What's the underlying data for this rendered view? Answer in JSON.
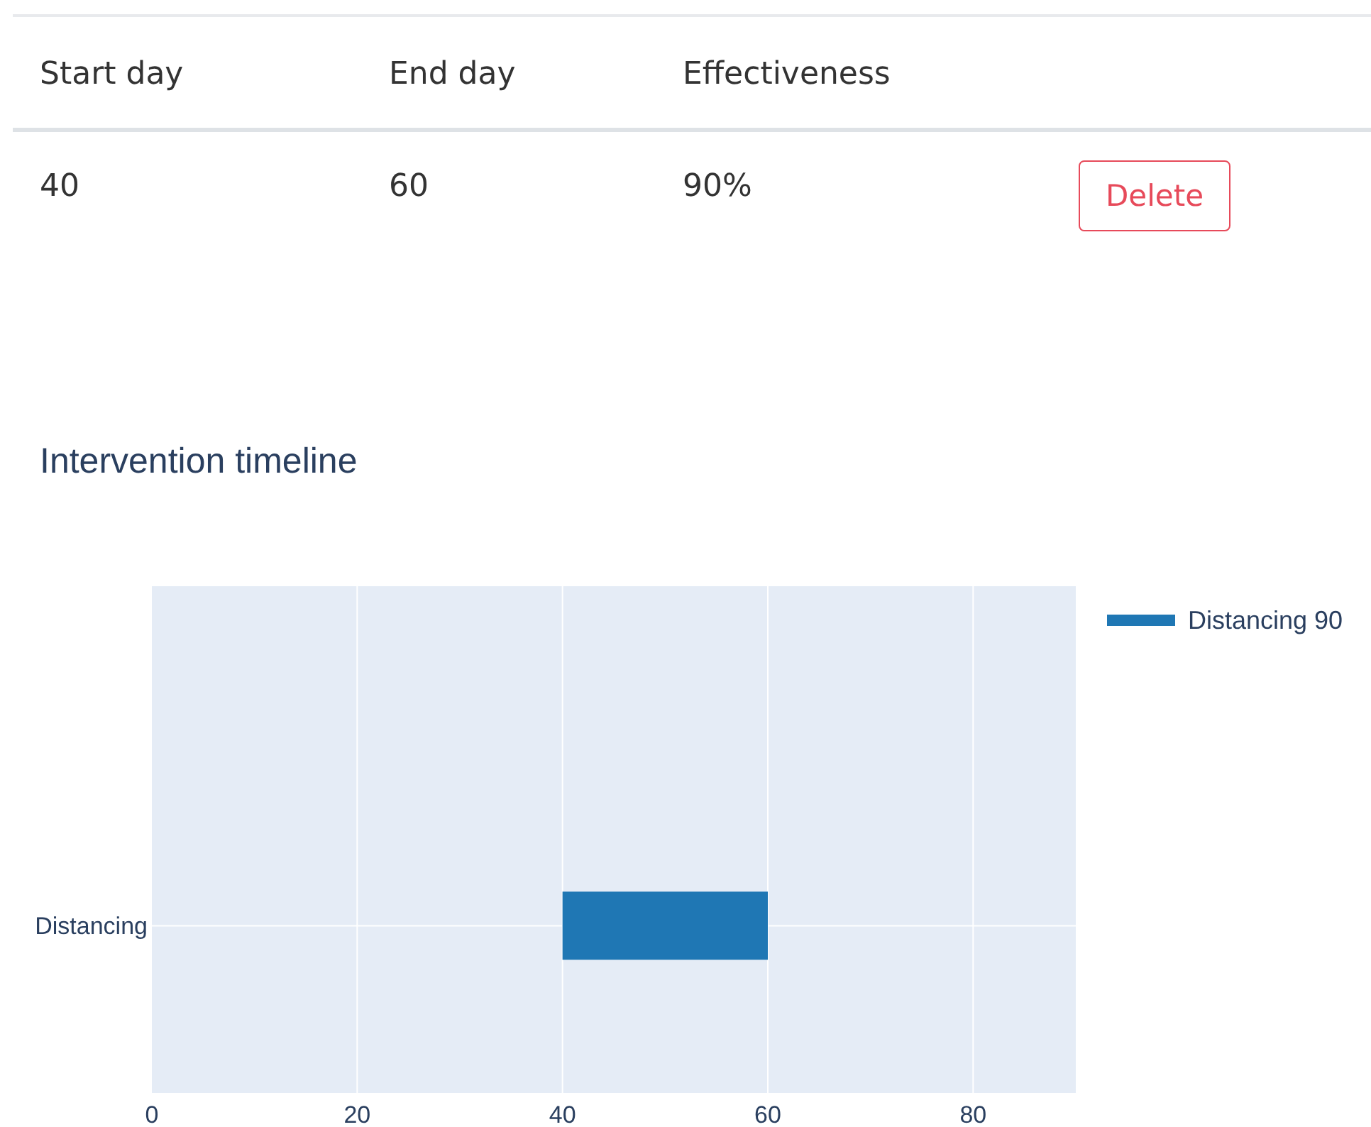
{
  "table": {
    "columns": [
      "Start day",
      "End day",
      "Effectiveness"
    ],
    "rows": [
      {
        "cells": [
          "40",
          "60",
          "90%"
        ],
        "action": "Delete"
      }
    ]
  },
  "chart_title": "Intervention timeline",
  "chart": {
    "chart_data": {
      "type": "bar",
      "orientation": "h",
      "categories": [
        "Distancing"
      ],
      "series": [
        {
          "name": "Distancing 90",
          "color": "#1f77b4",
          "values": [
            20
          ],
          "base": [
            40
          ]
        }
      ],
      "xlim": [
        0,
        90
      ],
      "grid": true,
      "xticks": [
        0,
        20,
        40,
        60,
        80
      ]
    }
  }
}
